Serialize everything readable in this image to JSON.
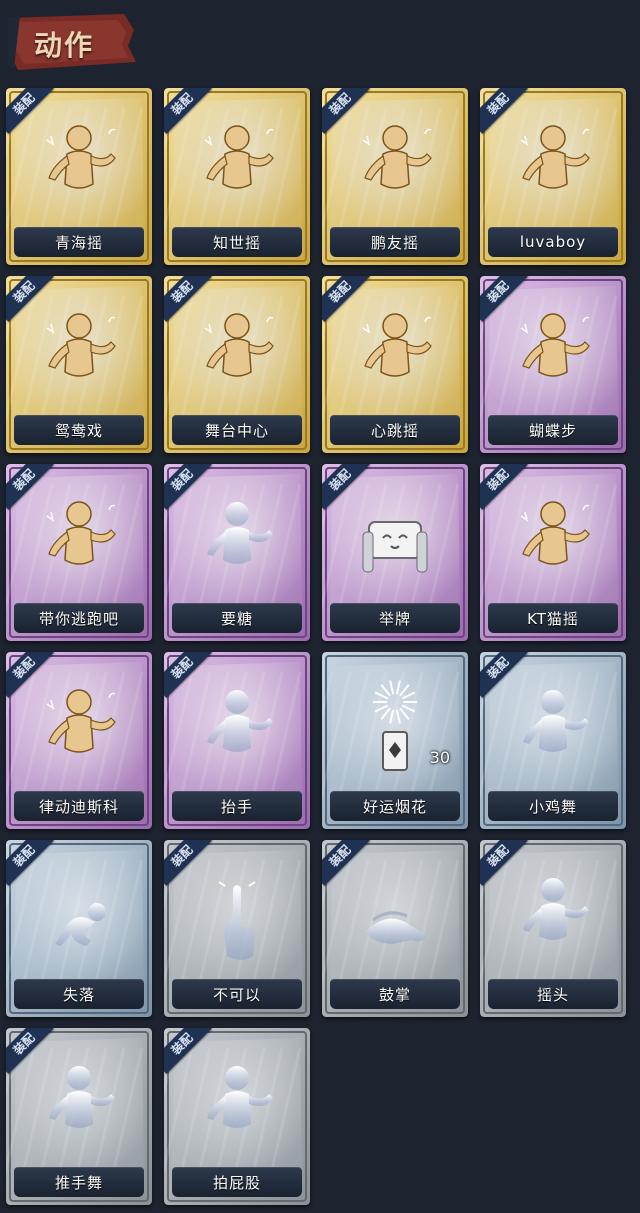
{
  "header": {
    "title": "动作"
  },
  "tag_label": "装配",
  "colors": {
    "gold": "#d2b25c",
    "purple": "#a87ab6",
    "blue": "#8da2b4",
    "gray": "#9aa2a8"
  },
  "items": [
    {
      "name": "青海摇",
      "tier": "gold",
      "tag": true,
      "figure": "dancer-icon"
    },
    {
      "name": "知世摇",
      "tier": "gold",
      "tag": true,
      "figure": "dancer-icon"
    },
    {
      "name": "鹏友摇",
      "tier": "gold",
      "tag": true,
      "figure": "dancer-icon"
    },
    {
      "name": "luvaboy",
      "tier": "gold",
      "tag": true,
      "figure": "dancer-icon"
    },
    {
      "name": "鸳鸯戏",
      "tier": "gold",
      "tag": true,
      "figure": "dancer-icon"
    },
    {
      "name": "舞台中心",
      "tier": "gold",
      "tag": true,
      "figure": "dancer-icon"
    },
    {
      "name": "心跳摇",
      "tier": "gold",
      "tag": true,
      "figure": "dancer-icon"
    },
    {
      "name": "蝴蝶步",
      "tier": "purple",
      "tag": true,
      "figure": "dancer-icon"
    },
    {
      "name": "带你逃跑吧",
      "tier": "purple",
      "tag": true,
      "figure": "dancer-icon"
    },
    {
      "name": "要糖",
      "tier": "purple",
      "tag": true,
      "figure": "ghost-figure-icon"
    },
    {
      "name": "举牌",
      "tier": "purple",
      "tag": true,
      "figure": "sign-icon"
    },
    {
      "name": "KT猫摇",
      "tier": "purple",
      "tag": true,
      "figure": "dancer-icon"
    },
    {
      "name": "律动迪斯科",
      "tier": "purple",
      "tag": true,
      "figure": "dancer-icon"
    },
    {
      "name": "抬手",
      "tier": "purple",
      "tag": true,
      "figure": "ghost-figure-icon"
    },
    {
      "name": "好运烟花",
      "tier": "blue",
      "tag": false,
      "figure": "firework-icon",
      "count": "30"
    },
    {
      "name": "小鸡舞",
      "tier": "blue",
      "tag": true,
      "figure": "silver-figure-icon"
    },
    {
      "name": "失落",
      "tier": "blue",
      "tag": true,
      "figure": "crawl-figure-icon"
    },
    {
      "name": "不可以",
      "tier": "gray",
      "tag": true,
      "figure": "finger-icon"
    },
    {
      "name": "鼓掌",
      "tier": "gray",
      "tag": true,
      "figure": "clap-icon"
    },
    {
      "name": "摇头",
      "tier": "gray",
      "tag": true,
      "figure": "ghost-figure-icon"
    },
    {
      "name": "推手舞",
      "tier": "gray",
      "tag": true,
      "figure": "ghost-figure-icon"
    },
    {
      "name": "拍屁股",
      "tier": "gray",
      "tag": true,
      "figure": "ghost-figure-icon"
    }
  ]
}
